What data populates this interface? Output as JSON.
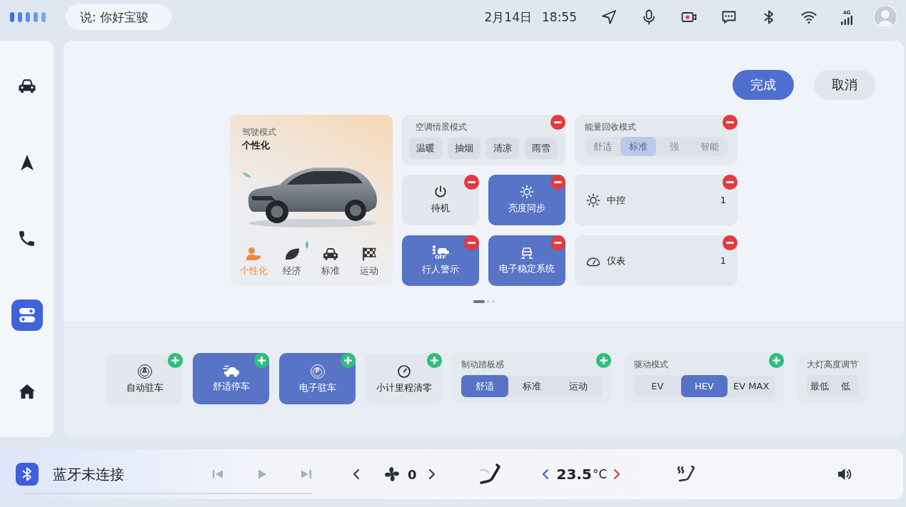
{
  "status_bar": {
    "voice_hint": "说: 你好宝骏",
    "date": "2月14日",
    "time": "18:55",
    "network": "4G"
  },
  "sidebar": {
    "items": [
      {
        "kind": "car",
        "selected": false
      },
      {
        "kind": "navigation",
        "selected": false
      },
      {
        "kind": "phone",
        "selected": false
      },
      {
        "kind": "controls",
        "selected": true
      },
      {
        "kind": "home",
        "selected": false
      }
    ]
  },
  "editor": {
    "actions": [
      {
        "kind": "primary",
        "label": "完成"
      },
      {
        "kind": "secondary",
        "label": "取消"
      }
    ],
    "drive_mode": {
      "title": "驾驶模式",
      "value": "个性化",
      "modes": [
        {
          "kind": "personal",
          "label": "个性化",
          "selected": true
        },
        {
          "kind": "eco",
          "label": "经济",
          "selected": false
        },
        {
          "kind": "standard",
          "label": "标准",
          "selected": false
        },
        {
          "kind": "sport",
          "label": "运动",
          "selected": false
        }
      ]
    },
    "widgets": [
      {
        "kind": "options",
        "title": "空调情景模式",
        "removable": true,
        "options": [
          {
            "label": "温暖",
            "selected": false
          },
          {
            "label": "抽烟",
            "selected": false
          },
          {
            "label": "清凉",
            "selected": false
          },
          {
            "label": "雨雪",
            "selected": false
          }
        ]
      },
      {
        "kind": "segmented",
        "title": "能量回收模式",
        "removable": true,
        "disabled": true,
        "options": [
          {
            "label": "舒适",
            "selected": false
          },
          {
            "label": "标准",
            "selected": true
          },
          {
            "label": "强",
            "selected": false
          },
          {
            "label": "智能",
            "selected": false
          }
        ]
      },
      {
        "kind": "toggle",
        "label": "待机",
        "on": false,
        "removable": true
      },
      {
        "kind": "toggle",
        "label": "亮度同步",
        "on": true,
        "removable": true
      },
      {
        "kind": "value",
        "label": "中控",
        "value": "1",
        "removable": true
      },
      {
        "kind": "toggle",
        "icon_text": "OFF",
        "label": "行人警示",
        "on": true,
        "removable": true
      },
      {
        "kind": "toggle",
        "label": "电子稳定系统",
        "on": true,
        "removable": true
      },
      {
        "kind": "value",
        "label": "仪表",
        "value": "1",
        "removable": true
      }
    ],
    "pages": [
      {
        "selected": true
      },
      {
        "selected": false
      },
      {
        "selected": false
      }
    ],
    "tray": [
      {
        "kind": "toggle",
        "icon_text": "A",
        "label": "自动驻车",
        "on": false,
        "addable": true
      },
      {
        "kind": "toggle",
        "label": "舒适停车",
        "on": true,
        "addable": true
      },
      {
        "kind": "toggle",
        "icon_text": "P",
        "label": "电子驻车",
        "on": true,
        "addable": true
      },
      {
        "kind": "toggle",
        "label": "小计里程清零",
        "on": false,
        "addable": true
      },
      {
        "kind": "segmented",
        "title": "制动踏板感",
        "addable": true,
        "disabled": false,
        "options": [
          {
            "label": "舒适",
            "selected": true
          },
          {
            "label": "标准",
            "selected": false
          },
          {
            "label": "运动",
            "selected": false
          }
        ]
      },
      {
        "kind": "segmented",
        "title": "驱动模式",
        "addable": true,
        "disabled": false,
        "options": [
          {
            "label": "EV",
            "selected": false
          },
          {
            "label": "HEV",
            "selected": true
          },
          {
            "label": "EV MAX",
            "selected": false
          }
        ]
      },
      {
        "kind": "segmented",
        "title": "大灯高度调节",
        "disabled": false,
        "options": [
          {
            "label": "最低",
            "selected": false
          },
          {
            "label": "低",
            "selected": false
          }
        ]
      }
    ]
  },
  "media_bar": {
    "bluetooth_status": "蓝牙未连接",
    "controls": [
      {
        "kind": "previous",
        "disabled": true
      },
      {
        "kind": "play",
        "disabled": true
      },
      {
        "kind": "next",
        "disabled": true
      }
    ],
    "fan_speed": "0",
    "temperature": {
      "value": "23.5",
      "unit": "°C"
    }
  }
}
